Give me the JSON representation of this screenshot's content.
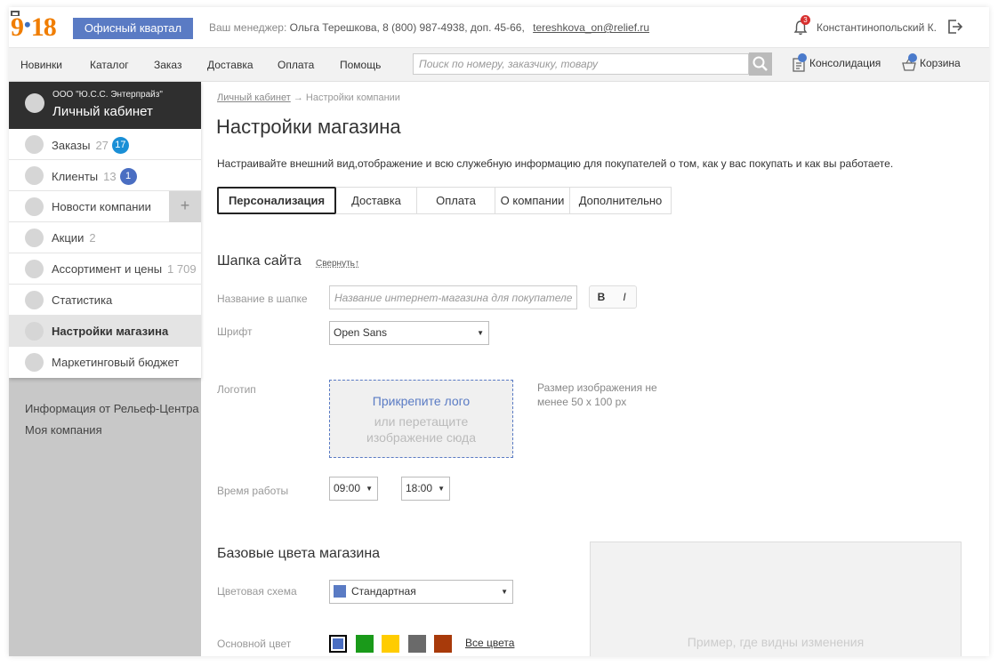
{
  "header": {
    "logo_text_left": "9",
    "logo_dot": "•",
    "logo_text_right": "18",
    "office_button": "Офисный квартал",
    "manager_label": "Ваш менеджер:",
    "manager_info": "Ольга Терешкова, 8 (800) 987-4938, доп. 45-66,",
    "manager_email": "tereshkova_on@relief.ru",
    "notifications_count": "3",
    "user_name": "Константинопольский К."
  },
  "nav": {
    "items": [
      "Новинки",
      "Каталог",
      "Заказ",
      "Доставка",
      "Оплата",
      "Помощь"
    ],
    "search_placeholder": "Поиск по номеру, заказчику, товару",
    "consolidation": "Консолидация",
    "cart": "Корзина"
  },
  "sidebar": {
    "company": "ООО \"Ю.С.С. Энтерпрайз\"",
    "cabinet": "Личный кабинет",
    "items": [
      {
        "label": "Заказы",
        "count": "27",
        "badge": "17",
        "badge_color": "#1a8fd6"
      },
      {
        "label": "Клиенты",
        "count": "13",
        "badge": "1",
        "badge_color": "#4a6ec2"
      },
      {
        "label": "Новости компании",
        "plus": "+"
      },
      {
        "label": "Акции",
        "count": "2"
      },
      {
        "label": "Ассортимент и цены",
        "count": "1 709"
      },
      {
        "label": "Статистика"
      },
      {
        "label": "Настройки магазина"
      },
      {
        "label": "Маркетинговый бюджет"
      }
    ],
    "links": [
      "Информация от  Рельеф-Центра",
      "Моя компания"
    ]
  },
  "main": {
    "breadcrumb_link": "Личный кабинет",
    "breadcrumb_arrow": "→",
    "breadcrumb_current": "Настройки компании",
    "title": "Настройки магазина",
    "description": "Настраивайте внешний вид,отображение и всю служебную информацию для покупателей о том, как у вас покупать и как вы работаете.",
    "tabs": [
      "Персонализация",
      "Доставка",
      "Оплата",
      "О компании",
      "Дополнительно"
    ],
    "header_section": {
      "title": "Шапка сайта",
      "collapse": "Свернуть",
      "collapse_arrow": "↑",
      "name_label": "Название в шапке",
      "name_placeholder": "Название интернет-магазина для покупателей",
      "bold": "B",
      "italic": "I",
      "font_label": "Шрифт",
      "font_value": "Open Sans",
      "logo_label": "Логотип",
      "logo_attach": "Прикрепите лого",
      "logo_drag": "или перетащите изображение сюда",
      "logo_size_note": "Размер изображения не менее 50 х 100 px",
      "hours_label": "Время работы",
      "hours_from": "09:00",
      "hours_to": "18:00"
    },
    "colors_section": {
      "title": "Базовые цвета магазина",
      "scheme_label": "Цветовая схема",
      "scheme_value": "Стандартная",
      "scheme_color": "#5a7bc4",
      "main_color_label": "Основной цвет",
      "swatches": [
        "#4a6ec2",
        "#1a9a1a",
        "#ffcc00",
        "#6a6a6a",
        "#a83a0a"
      ],
      "all_colors": "Все цвета",
      "preview_text": "Пример, где видны изменения"
    }
  }
}
